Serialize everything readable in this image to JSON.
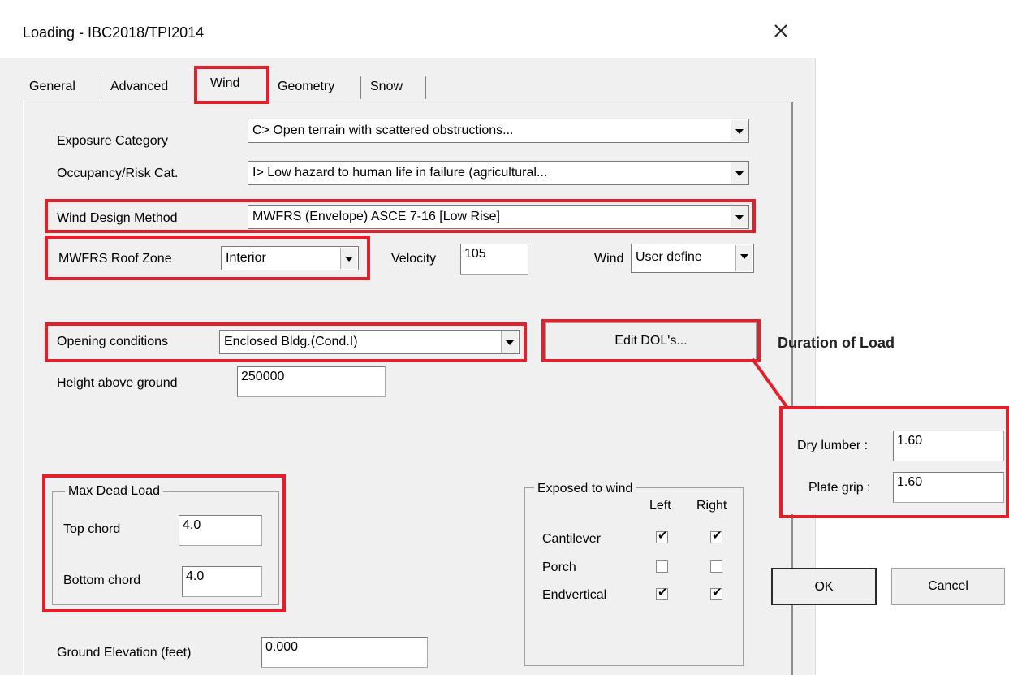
{
  "window": {
    "title": "Loading - IBC2018/TPI2014"
  },
  "tabs": [
    {
      "label": "General",
      "selected": false
    },
    {
      "label": "Advanced",
      "selected": false
    },
    {
      "label": "Wind",
      "selected": true
    },
    {
      "label": "Geometry",
      "selected": false
    },
    {
      "label": "Snow",
      "selected": false
    }
  ],
  "form": {
    "exposure_category": {
      "label": "Exposure Category",
      "value": "C> Open terrain with scattered obstructions..."
    },
    "occupancy": {
      "label": "Occupancy/Risk Cat.",
      "value": "I> Low hazard to human life in failure (agricultural..."
    },
    "wind_design_method": {
      "label": "Wind Design Method",
      "value": "MWFRS (Envelope) ASCE 7-16 [Low Rise]"
    },
    "roof_zone": {
      "label": "MWFRS Roof Zone",
      "value": "Interior"
    },
    "velocity": {
      "label": "Velocity",
      "value": "105"
    },
    "wind": {
      "label": "Wind",
      "value": "User define"
    },
    "opening_conditions": {
      "label": "Opening conditions",
      "value": "Enclosed Bldg.(Cond.I)"
    },
    "edit_dol_button": "Edit DOL's...",
    "height_above_ground": {
      "label": "Height above ground",
      "value": "250000"
    },
    "max_dead_load": {
      "title": "Max Dead Load",
      "top_chord": {
        "label": "Top chord",
        "value": "4.0"
      },
      "bottom_chord": {
        "label": "Bottom chord",
        "value": "4.0"
      }
    },
    "exposed_to_wind": {
      "title": "Exposed to wind",
      "col_left": "Left",
      "col_right": "Right",
      "rows": [
        {
          "label": "Cantilever",
          "left": true,
          "right": true
        },
        {
          "label": "Porch",
          "left": false,
          "right": false
        },
        {
          "label": "Endvertical",
          "left": true,
          "right": true
        }
      ]
    },
    "ground_elevation": {
      "label": "Ground Elevation (feet)",
      "value": "0.000"
    }
  },
  "dol_panel": {
    "title": "Duration of Load",
    "dry_lumber": {
      "label": "Dry lumber :",
      "value": "1.60"
    },
    "plate_grip": {
      "label": "Plate grip :",
      "value": "1.60"
    },
    "ok_button": "OK",
    "cancel_button": "Cancel"
  },
  "colors": {
    "highlight": "#e3202a",
    "dialog_bg": "#f0f0f0"
  },
  "icons": {
    "close": "close-icon",
    "dropdown": "chevron-down-icon",
    "check": "checkmark-icon"
  }
}
